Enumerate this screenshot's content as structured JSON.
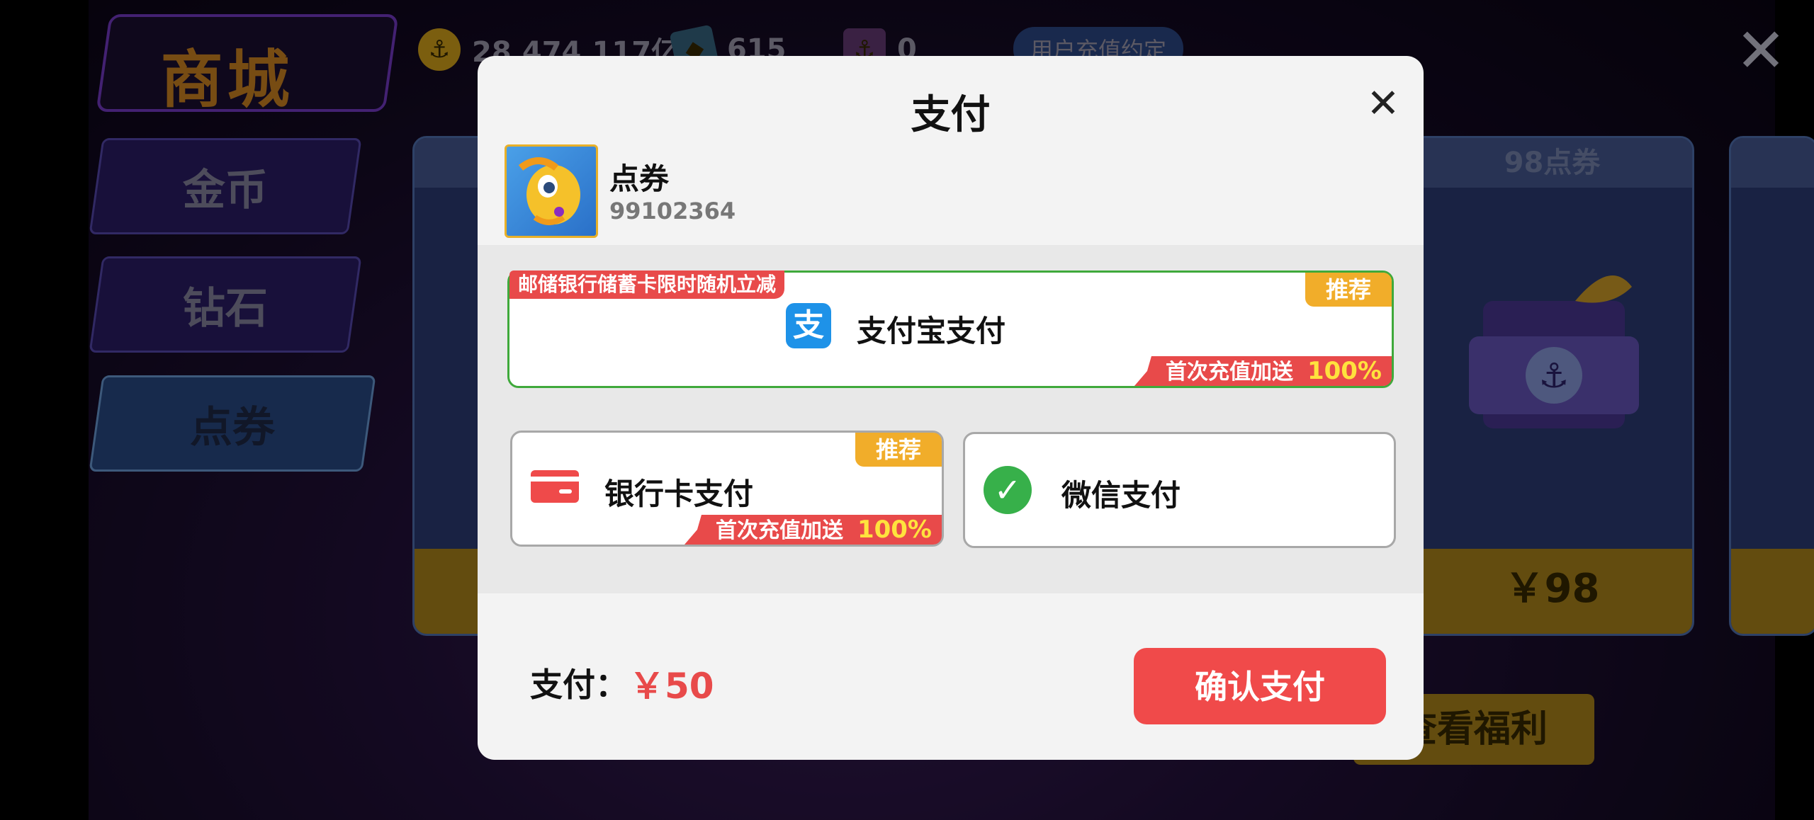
{
  "game": {
    "shop_title": "商城",
    "resources": {
      "gold": "28,474,117亿",
      "diamond": "615",
      "ticket": "0"
    },
    "agreement_tab": "用户充值约定",
    "sidebar": [
      {
        "label": "金币"
      },
      {
        "label": "钻石"
      },
      {
        "label": "点券",
        "selected": true
      }
    ],
    "cards": {
      "right_title": "98点券",
      "right_price": "￥98"
    },
    "benefit_button": "查看福利"
  },
  "modal": {
    "title": "支付",
    "product": {
      "name": "点券",
      "id": "99102364"
    },
    "methods": {
      "alipay": {
        "label": "支付宝支付",
        "promo_tag": "邮储银行储蓄卡限时随机立减",
        "badge": "推荐",
        "bonus_text": "首次充值加送",
        "bonus_pct": "100%"
      },
      "bank": {
        "label": "银行卡支付",
        "badge": "推荐",
        "bonus_text": "首次充值加送",
        "bonus_pct": "100%"
      },
      "wechat": {
        "label": "微信支付"
      }
    },
    "pay_label": "支付：",
    "pay_amount": "￥50",
    "confirm_label": "确认支付"
  },
  "colors": {
    "accent_red": "#f04a4a",
    "alipay_blue": "#1e92e8",
    "wechat_green": "#37b04a",
    "recommend_orange": "#f1ad2a"
  }
}
